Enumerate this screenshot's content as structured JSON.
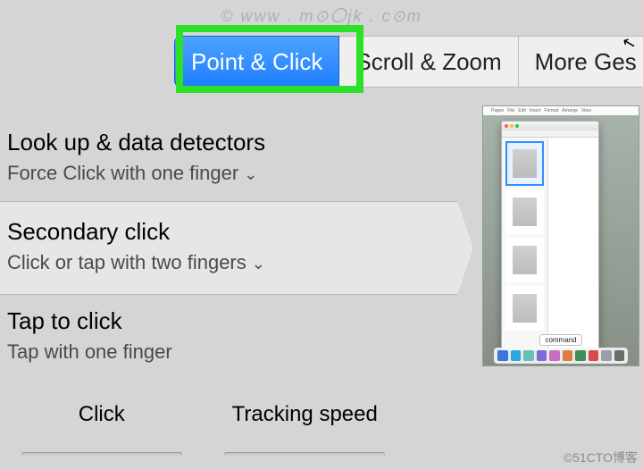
{
  "watermark_top": "©  www . m⊙〇jk . c⊙m",
  "watermark_bottom": "©51CTO博客",
  "tabs": {
    "point_click": "Point & Click",
    "scroll_zoom": "Scroll & Zoom",
    "more_gestures": "More Ges"
  },
  "options": {
    "lookup": {
      "title": "Look up & data detectors",
      "sub": "Force Click with one finger"
    },
    "secondary": {
      "title": "Secondary click",
      "sub": "Click or tap with two fingers"
    },
    "tap": {
      "title": "Tap to click",
      "sub": "Tap with one finger"
    }
  },
  "sliders": {
    "click": "Click",
    "tracking": "Tracking speed"
  },
  "preview": {
    "menubar": [
      "Pages",
      "File",
      "Edit",
      "Insert",
      "Format",
      "Arrange",
      "View"
    ],
    "dock_tooltip": "command",
    "dock_colors": [
      "#3a78d8",
      "#2aa7e0",
      "#68c1b1",
      "#7a6cd9",
      "#c76fbf",
      "#e07b45",
      "#3c8f5a",
      "#d94b4b",
      "#96a0ad",
      "#6b6b6b"
    ]
  }
}
